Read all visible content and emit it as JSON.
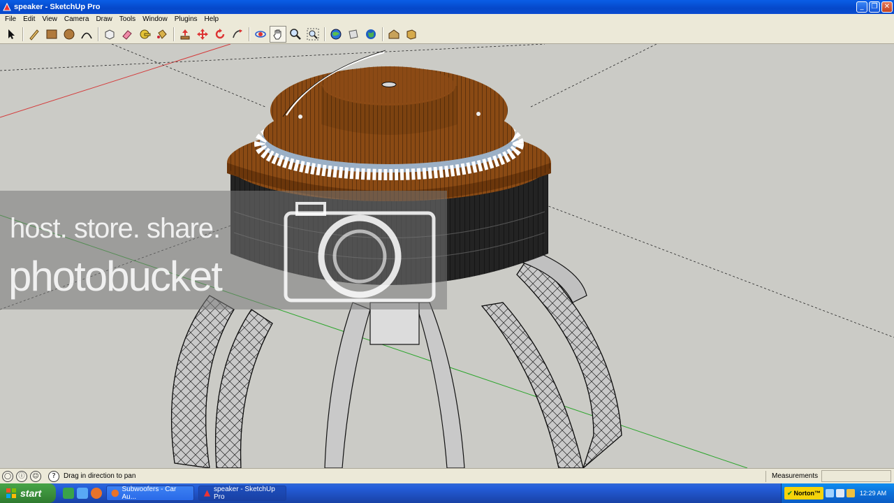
{
  "window": {
    "title": "speaker - SketchUp Pro",
    "minimize": "_",
    "maximize": "❐",
    "close": "✕"
  },
  "menu": [
    "File",
    "Edit",
    "View",
    "Camera",
    "Draw",
    "Tools",
    "Window",
    "Plugins",
    "Help"
  ],
  "toolbar": {
    "tools": [
      "select",
      "pencil",
      "rectangle",
      "circle",
      "arc",
      "make-component",
      "eraser",
      "tape-measure",
      "paint-bucket",
      "push-pull",
      "move",
      "rotate",
      "offset",
      "orbit",
      "pan",
      "zoom",
      "zoom-extents",
      "get-models",
      "share-model",
      "google-earth",
      "warehouse",
      "component"
    ]
  },
  "watermark": {
    "line1": "host. store. share.",
    "line2": "photobucket"
  },
  "status": {
    "hint": "Drag in direction to pan",
    "measurements_label": "Measurements",
    "help": "?"
  },
  "taskbar": {
    "start": "start",
    "tasks": [
      {
        "label": "Subwoofers - Car Au...",
        "active": false
      },
      {
        "label": "speaker - SketchUp Pro",
        "active": true
      }
    ],
    "tray_label": "Norton™",
    "clock": "12:29 AM"
  },
  "colors": {
    "titlebar": "#0548c9",
    "chrome": "#ece9d8",
    "viewport": "#cbcbc6",
    "speaker_brown": "#8a4a14",
    "taskbar": "#245edb"
  }
}
